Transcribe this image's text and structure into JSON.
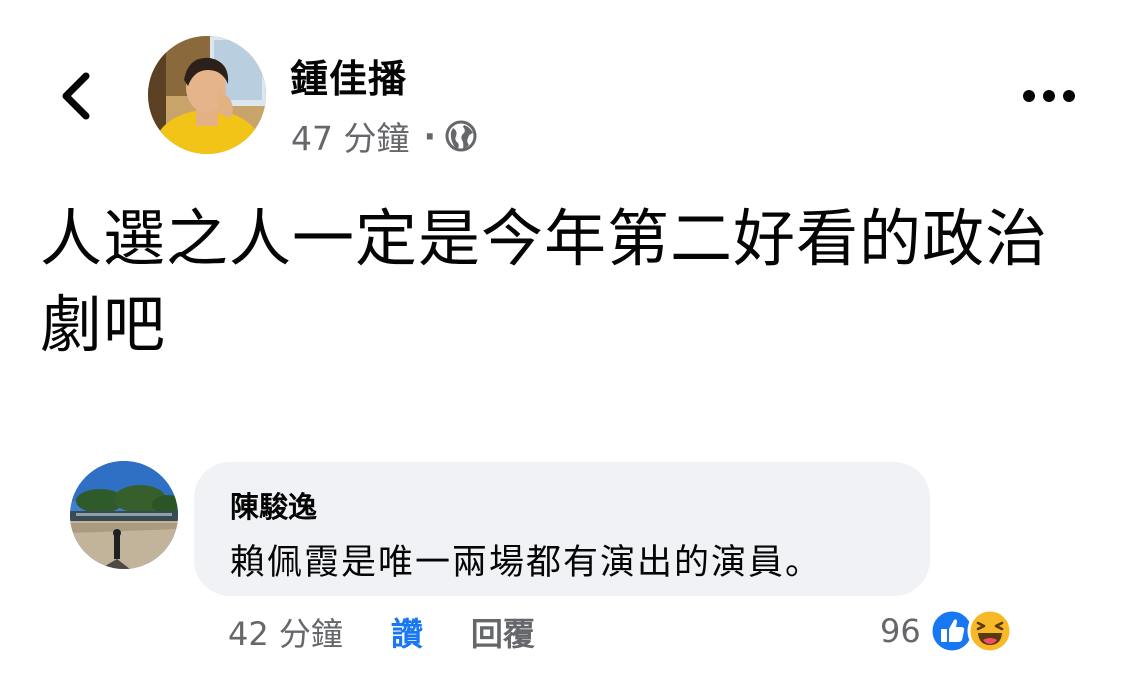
{
  "post": {
    "author_name": "鍾佳播",
    "timestamp": "47 分鐘",
    "meta_separator": "·",
    "privacy_icon": "globe-icon",
    "text": "人選之人一定是今年第二好看的政治劇吧"
  },
  "header": {
    "back_icon": "chevron-left-icon",
    "more_icon": "more-horizontal-icon"
  },
  "comment": {
    "author_name": "陳駿逸",
    "text": "賴佩霞是唯一兩場都有演出的演員。",
    "timestamp": "42 分鐘",
    "like_label": "讚",
    "reply_label": "回覆",
    "reaction_count": "96",
    "reaction_icons": [
      "like-icon",
      "haha-icon"
    ]
  },
  "colors": {
    "accent": "#1877f2",
    "secondary_text": "#65676b",
    "bubble": "#f0f2f5",
    "haha": "#f7b928"
  }
}
